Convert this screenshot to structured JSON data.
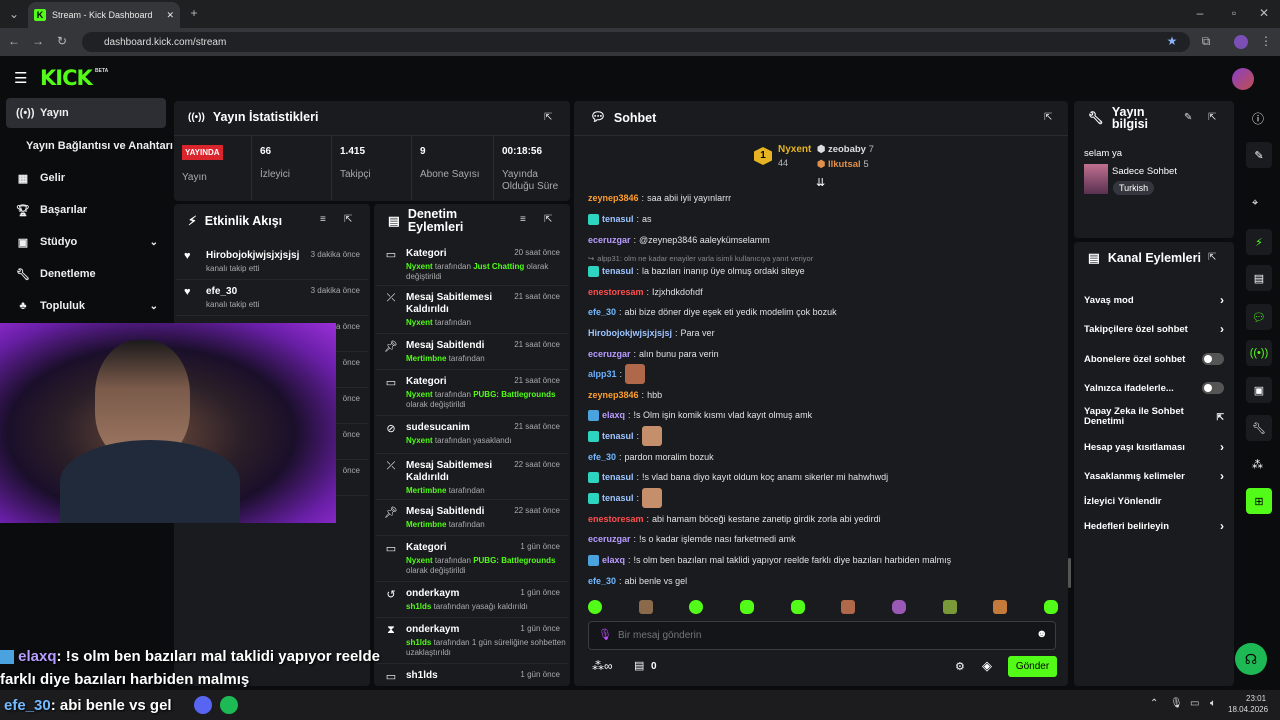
{
  "browser": {
    "tab_title": "Stream - Kick Dashboard",
    "url": "dashboard.kick.com/stream"
  },
  "brand": {
    "logo": "KICK",
    "beta": "BETA",
    "accent": "#53fc18"
  },
  "sidebar": {
    "items": [
      {
        "label": "Yayın",
        "icon": "broadcast-icon"
      },
      {
        "label": "Yayın Bağlantısı ve Anahtarı"
      },
      {
        "label": "Gelir",
        "icon": "chart-icon"
      },
      {
        "label": "Başarılar",
        "icon": "trophy-icon"
      },
      {
        "label": "Stüdyo",
        "icon": "studio-icon"
      },
      {
        "label": "Denetleme",
        "icon": "wrench-icon"
      },
      {
        "label": "Topluluk",
        "icon": "community-icon"
      }
    ]
  },
  "stats": {
    "title": "Yayın İstatistikleri",
    "live_badge": "YAYINDA",
    "items": [
      {
        "value": "",
        "label": "Yayın"
      },
      {
        "value": "66",
        "label": "İzleyici"
      },
      {
        "value": "1.415",
        "label": "Takipçi"
      },
      {
        "value": "9",
        "label": "Abone Sayısı"
      },
      {
        "value": "00:18:56",
        "label": "Yayında Olduğu Süre"
      }
    ]
  },
  "activity": {
    "title": "Etkinlik Akışı",
    "events": [
      {
        "name": "Hirobojokjwjsjxjsjsj",
        "sub": "kanalı takip etti",
        "time": "3 dakika önce"
      },
      {
        "name": "efe_30",
        "sub": "kanalı takip etti",
        "time": "3 dakika önce"
      },
      {
        "time": "3 dakika önce"
      },
      {
        "time": "önce"
      },
      {
        "time": "önce"
      },
      {
        "time": "önce"
      },
      {
        "time": "önce"
      }
    ]
  },
  "moderation": {
    "title": "Denetim Eylemleri",
    "items": [
      {
        "title": "Kategori",
        "time": "20 saat önce",
        "user": "Nyxent",
        "mid": "tarafından",
        "extra": "Just Chatting",
        "tail": "olarak değiştirildi"
      },
      {
        "title": "Mesaj Sabitlemesi Kaldırıldı",
        "time": "21 saat önce",
        "user": "Nyxent",
        "mid": "tarafından"
      },
      {
        "title": "Mesaj Sabitlendi",
        "time": "21 saat önce",
        "user": "Mertimbne",
        "mid": "tarafından"
      },
      {
        "title": "Kategori",
        "time": "21 saat önce",
        "user": "Nyxent",
        "mid": "tarafından",
        "extra": "PUBG: Battlegrounds",
        "tail": "olarak değiştirildi"
      },
      {
        "title": "sudesucanim",
        "time": "21 saat önce",
        "user": "Nyxent",
        "mid": "tarafından yasaklandı"
      },
      {
        "title": "Mesaj Sabitlemesi Kaldırıldı",
        "time": "22 saat önce",
        "user": "Mertimbne",
        "mid": "tarafından"
      },
      {
        "title": "Mesaj Sabitlendi",
        "time": "22 saat önce",
        "user": "Mertimbne",
        "mid": "tarafından"
      },
      {
        "title": "Kategori",
        "time": "1 gün önce",
        "user": "Nyxent",
        "mid": "tarafından",
        "extra": "PUBG: Battlegrounds",
        "tail": "olarak değiştirildi"
      },
      {
        "title": "onderkaym",
        "time": "1 gün önce",
        "user": "sh1lds",
        "mid": "tarafından yasağı kaldırıldı"
      },
      {
        "title": "onderkaym",
        "time": "1 gün önce",
        "user": "sh1lds",
        "mid": "tarafından 1 gün süreliğine sohbetten uzaklaştırıldı"
      },
      {
        "title": "sh1lds",
        "time": "1 gün önce"
      }
    ]
  },
  "chat": {
    "title": "Sohbet",
    "top": [
      {
        "name": "Nyxent",
        "count": "44",
        "rank": "1"
      },
      {
        "name": "zeobaby",
        "count": "7"
      },
      {
        "name": "Ilkutsal",
        "count": "5"
      }
    ],
    "reply_hint": "alpp31: olm ne kadar enayiler varla isimli kullanıcıya yanıt veriyor",
    "messages": [
      {
        "user": "zeynep3846",
        "color": "#ff9d2e",
        "text": "saa abii iyii yayınlarrr"
      },
      {
        "user": "tenasul",
        "color": "#9ec5ff",
        "text": "as",
        "badge": true
      },
      {
        "user": "eceruzgar",
        "color": "#b99cff",
        "text": "@zeynep3846 aaleykümselamm"
      },
      {
        "user": "tenasul",
        "color": "#9ec5ff",
        "text": "la bazıları inanıp üye olmuş ordaki siteye",
        "badge": true
      },
      {
        "user": "enestoresam",
        "color": "#ff4f4f",
        "text": "Izjxhdkdofıdf"
      },
      {
        "user": "efe_30",
        "color": "#74b9ff",
        "text": "abi bize döner diye eşek eti yedik modelim çok bozuk"
      },
      {
        "user": "Hirobojokjwjsjxjsjsj",
        "color": "#9ec5ff",
        "text": "Para ver"
      },
      {
        "user": "eceruzgar",
        "color": "#b99cff",
        "text": "alın bunu para verin"
      },
      {
        "user": "alpp31",
        "color": "#6ab0ff",
        "text": "",
        "emote": true
      },
      {
        "user": "zeynep3846",
        "color": "#ff9d2e",
        "text": "hbb"
      },
      {
        "user": "elaxq",
        "color": "#b99cff",
        "text": "!s Olm işin komik kısmı vlad kayıt olmuş amk",
        "badge": true
      },
      {
        "user": "tenasul",
        "color": "#9ec5ff",
        "text": "",
        "badge": true,
        "emote": true
      },
      {
        "user": "efe_30",
        "color": "#74b9ff",
        "text": "pardon moralim bozuk"
      },
      {
        "user": "tenasul",
        "color": "#9ec5ff",
        "text": "!s vlad bana diyo kayıt oldum koç anamı sikerler mi hahwhwdj",
        "badge": true
      },
      {
        "user": "tenasul",
        "color": "#9ec5ff",
        "text": "",
        "badge": true,
        "emote": true
      },
      {
        "user": "enestoresam",
        "color": "#ff4f4f",
        "text": "abi hamam böceği kestane zanetip girdik zorla abi yedirdi"
      },
      {
        "user": "eceruzgar",
        "color": "#b99cff",
        "text": "!s o kadar işlemde nası farketmedi amk"
      },
      {
        "user": "elaxq",
        "color": "#b99cff",
        "text": "!s olm ben bazıları mal taklidi yapıyor reelde farklı diye bazıları harbiden malmış",
        "badge": true
      },
      {
        "user": "efe_30",
        "color": "#74b9ff",
        "text": "abi benle vs gel"
      }
    ],
    "placeholder": "Bir mesaj gönderin",
    "points": "0",
    "send": "Gönder"
  },
  "stream_info": {
    "title": "Yayın bilgisi",
    "stream_title": "selam ya",
    "category": "Sadece Sohbet",
    "language": "Turkish"
  },
  "channel_actions": {
    "title": "Kanal Eylemleri",
    "items": [
      {
        "label": "Yavaş mod",
        "control": "chevron"
      },
      {
        "label": "Takipçilere özel sohbet",
        "control": "chevron"
      },
      {
        "label": "Abonelere özel sohbet",
        "control": "toggle"
      },
      {
        "label": "Yalnızca ifadelerle...",
        "control": "toggle"
      },
      {
        "label": "Yapay Zeka ile Sohbet Denetimi",
        "control": "external"
      },
      {
        "label": "Hesap yaşı kısıtlaması",
        "control": "chevron"
      },
      {
        "label": "Yasaklanmış kelimeler",
        "control": "chevron"
      },
      {
        "label": "İzleyici Yönlendir",
        "control": "none"
      },
      {
        "label": "Hedefleri belirleyin",
        "control": "chevron"
      }
    ]
  },
  "overlay": {
    "line1_user": "elaxq",
    "line1": ": !s olm ben bazıları mal taklidi yapıyor reelde",
    "line2": "farklı diye bazıları harbiden malmış",
    "line3_user": "efe_30",
    "line3": ": abi benle vs gel"
  },
  "taskbar": {
    "time": "23:01",
    "date": "18.04.2026"
  }
}
